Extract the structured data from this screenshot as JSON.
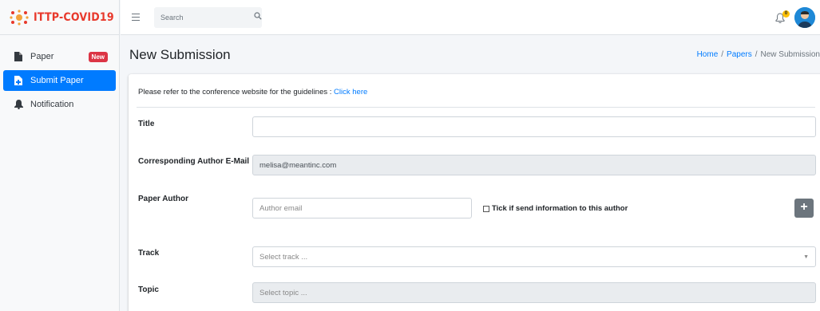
{
  "brand": {
    "name": "ITTP-COVID19"
  },
  "sidebar": {
    "items": [
      {
        "label": "Paper",
        "icon": "file-icon",
        "badge": "New"
      },
      {
        "label": "Submit Paper",
        "icon": "file-plus-icon",
        "active": true
      },
      {
        "label": "Notification",
        "icon": "bell-icon"
      }
    ]
  },
  "topbar": {
    "search_placeholder": "Search",
    "notification_count": "0"
  },
  "header": {
    "title": "New Submission",
    "breadcrumb": [
      "Home",
      "Papers",
      "New Submission"
    ]
  },
  "form": {
    "guideline_text": "Please refer to the conference website for the guidelines : ",
    "guideline_link": "Click here",
    "title_label": "Title",
    "title_value": "",
    "email_label": "Corresponding Author E-Mail",
    "email_value": "melisa@meantinc.com",
    "author_label": "Paper Author",
    "author_placeholder": "Author email",
    "author_checkbox_label": "Tick if send information to this author",
    "add_button": "+",
    "track_label": "Track",
    "track_placeholder": "Select track ...",
    "topic_label": "Topic",
    "topic_placeholder": "Select topic ..."
  },
  "colors": {
    "primary": "#007bff",
    "danger": "#dc3545",
    "brand": "#e8392c",
    "warning": "#ffc107"
  }
}
